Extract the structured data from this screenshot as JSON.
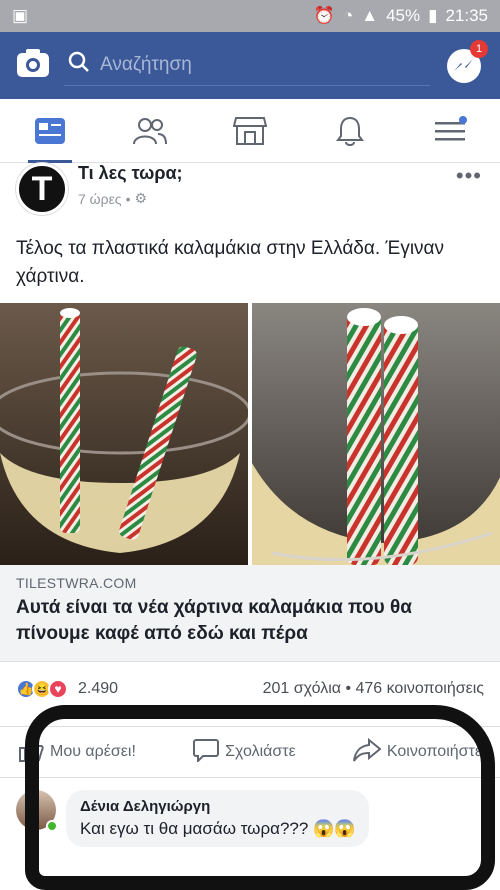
{
  "status": {
    "battery": "45%",
    "time": "21:35"
  },
  "search": {
    "placeholder": "Αναζήτηση"
  },
  "messenger": {
    "badge": "1"
  },
  "post": {
    "author": "Τι λες τωρα;",
    "time": "7 ώρες",
    "text": "Τέλος τα πλαστικά καλαμάκια στην Ελλάδα. Έγιναν χάρτινα.",
    "link_domain": "TILESTWRA.COM",
    "link_title": "Αυτά είναι τα νέα χάρτινα καλαμάκια που θα πίνουμε καφέ από εδώ και πέρα",
    "reactions_count": "2.490",
    "comments_shares": "201 σχόλια • 476 κοινοποιήσεις"
  },
  "actions": {
    "like": "Μου αρέσει!",
    "comment": "Σχολιάστε",
    "share": "Κοινοποιήστε"
  },
  "comment": {
    "author": "Δένια Δεληγιώργη",
    "text": "Και εγω τι θα μασάω τωρα??? 😱😱"
  }
}
